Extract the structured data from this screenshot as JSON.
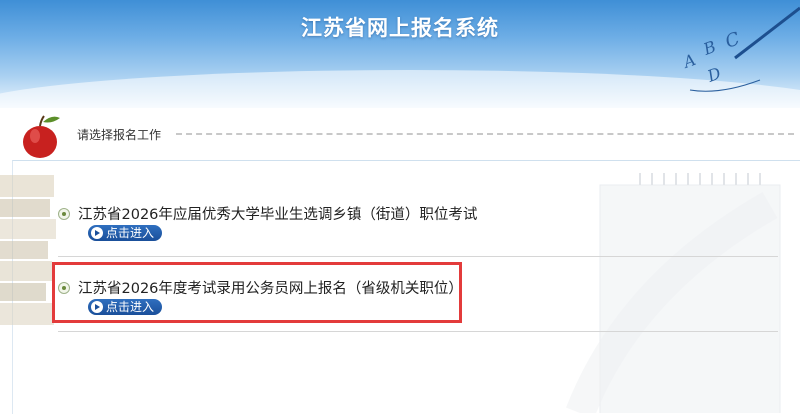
{
  "header": {
    "title": "江苏省网上报名系统",
    "deco_letters": [
      "A",
      "B",
      "C",
      "D"
    ]
  },
  "section": {
    "label": "请选择报名工作"
  },
  "items": [
    {
      "title": "江苏省2026年应届优秀大学毕业生选调乡镇（街道）职位考试",
      "button_label": "点击进入"
    },
    {
      "title": "江苏省2026年度考试录用公务员网上报名（省级机关职位）",
      "button_label": "点击进入",
      "highlighted": true
    }
  ],
  "colors": {
    "header_top": "#3f8fd6",
    "button": "#1a4f9a",
    "highlight_border": "#e33b3b"
  }
}
